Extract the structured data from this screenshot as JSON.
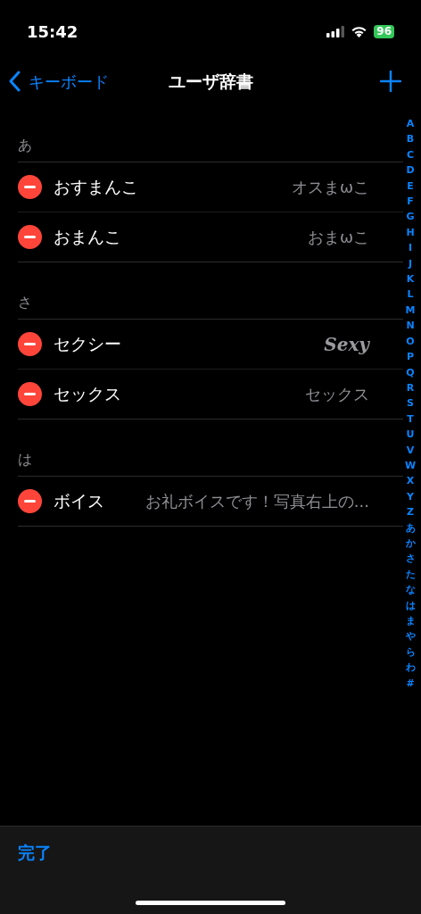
{
  "status_bar": {
    "time": "15:42",
    "battery": "96"
  },
  "nav": {
    "back": "キーボード",
    "title": "ユーザ辞書"
  },
  "sections": [
    {
      "header": "あ",
      "rows": [
        {
          "word": "おすまんこ",
          "reading": "オスまωこ",
          "kind": "plain"
        },
        {
          "word": "おまんこ",
          "reading": "おまωこ",
          "kind": "plain"
        }
      ]
    },
    {
      "header": "さ",
      "rows": [
        {
          "word": "セクシー",
          "reading": "Sexy",
          "kind": "serif"
        },
        {
          "word": "セックス",
          "reading": "セックス",
          "kind": "plain"
        }
      ]
    },
    {
      "header": "は",
      "rows": [
        {
          "word": "ボイス",
          "reading": "お礼ボイスです！写真右上の...",
          "kind": "plain"
        }
      ]
    }
  ],
  "index": [
    "A",
    "B",
    "C",
    "D",
    "E",
    "F",
    "G",
    "H",
    "I",
    "J",
    "K",
    "L",
    "M",
    "N",
    "O",
    "P",
    "Q",
    "R",
    "S",
    "T",
    "U",
    "V",
    "W",
    "X",
    "Y",
    "Z",
    "あ",
    "か",
    "さ",
    "た",
    "な",
    "は",
    "ま",
    "や",
    "ら",
    "わ",
    "#"
  ],
  "toolbar": {
    "done": "完了"
  }
}
